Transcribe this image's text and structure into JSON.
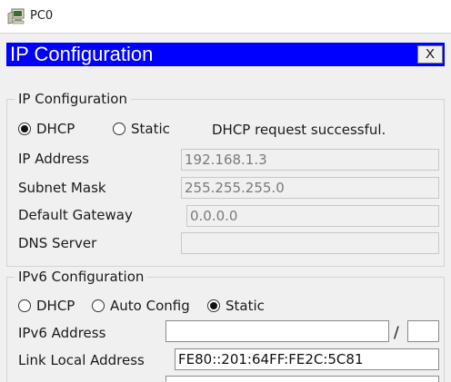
{
  "window": {
    "title": "PC0",
    "icon": "pc-icon"
  },
  "dialog": {
    "header_title": "IP Configuration",
    "close_label": "X"
  },
  "ipv4": {
    "group_title": "IP Configuration",
    "mode_options": [
      {
        "label": "DHCP",
        "checked": true
      },
      {
        "label": "Static",
        "checked": false
      }
    ],
    "status_text": "DHCP request successful.",
    "fields": {
      "ip_address": {
        "label": "IP Address",
        "value": "192.168.1.3"
      },
      "subnet_mask": {
        "label": "Subnet Mask",
        "value": "255.255.255.0"
      },
      "default_gateway": {
        "label": "Default Gateway",
        "value": "0.0.0.0"
      },
      "dns_server": {
        "label": "DNS Server",
        "value": ""
      }
    }
  },
  "ipv6": {
    "group_title": "IPv6 Configuration",
    "mode_options": [
      {
        "label": "DHCP",
        "checked": false
      },
      {
        "label": "Auto Config",
        "checked": false
      },
      {
        "label": "Static",
        "checked": true
      }
    ],
    "fields": {
      "ipv6_address": {
        "label": "IPv6 Address",
        "value": "",
        "separator": "/",
        "prefix_length": ""
      },
      "link_local_address": {
        "label": "Link Local Address",
        "value": "FE80::201:64FF:FE2C:5C81"
      }
    }
  }
}
